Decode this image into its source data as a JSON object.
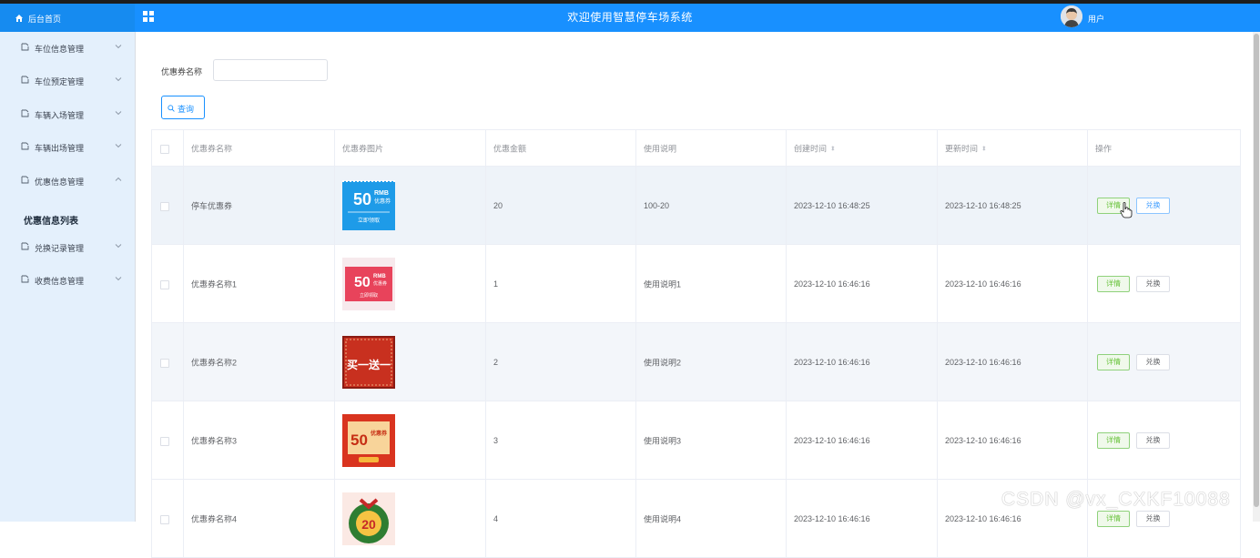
{
  "header": {
    "home_label": "后台首页",
    "title": "欢迎使用智慧停车场系统",
    "user_label": "用户",
    "bg_color": "#1890ff"
  },
  "sidebar": {
    "items": [
      {
        "label": "车位信息管理",
        "icon": "document-icon",
        "expanded": false
      },
      {
        "label": "车位预定管理",
        "icon": "document-icon",
        "expanded": false
      },
      {
        "label": "车辆入场管理",
        "icon": "document-icon",
        "expanded": false
      },
      {
        "label": "车辆出场管理",
        "icon": "document-icon",
        "expanded": false
      },
      {
        "label": "优惠信息管理",
        "icon": "document-icon",
        "expanded": true
      },
      {
        "label": "兑换记录管理",
        "icon": "document-icon",
        "expanded": false
      },
      {
        "label": "收费信息管理",
        "icon": "document-icon",
        "expanded": false
      }
    ],
    "active_sub": "优惠信息列表"
  },
  "search": {
    "label": "优惠券名称",
    "value": "",
    "placeholder": "",
    "button_label": "查询"
  },
  "table": {
    "columns": [
      "优惠券名称",
      "优惠券图片",
      "优惠金额",
      "使用说明",
      "创建时间",
      "更新时间",
      "操作"
    ],
    "sort_symbol": "⬍",
    "rows": [
      {
        "name": "停车优惠券",
        "amount": "20",
        "desc": "100-20",
        "created": "2023-12-10 16:48:25",
        "updated": "2023-12-10 16:48:25",
        "image": {
          "big": "50",
          "small": "RMB",
          "sub": "优惠券",
          "foot": "立即领取",
          "color": "#1e9be8"
        }
      },
      {
        "name": "优惠券名称1",
        "amount": "1",
        "desc": "使用说明1",
        "created": "2023-12-10 16:46:16",
        "updated": "2023-12-10 16:46:16",
        "image": {
          "big": "50",
          "small": "RMB",
          "sub": "优惠券",
          "foot": "立即领取",
          "color": "#e8435b"
        }
      },
      {
        "name": "优惠券名称2",
        "amount": "2",
        "desc": "使用说明2",
        "created": "2023-12-10 16:46:16",
        "updated": "2023-12-10 16:46:16",
        "image": {
          "big": "买一送一",
          "color": "#c8301f"
        }
      },
      {
        "name": "优惠券名称3",
        "amount": "3",
        "desc": "使用说明3",
        "created": "2023-12-10 16:46:16",
        "updated": "2023-12-10 16:46:16",
        "image": {
          "big": "50",
          "sub": "优惠券",
          "color": "#d9341f"
        }
      },
      {
        "name": "优惠券名称4",
        "amount": "4",
        "desc": "使用说明4",
        "created": "2023-12-10 16:46:16",
        "updated": "2023-12-10 16:46:16",
        "image": {
          "big": "20",
          "color": "#2e7d32"
        }
      }
    ],
    "detail_label": "详情",
    "exchange_label": "兑换"
  },
  "watermark": "CSDN @vx_CXKF10088"
}
